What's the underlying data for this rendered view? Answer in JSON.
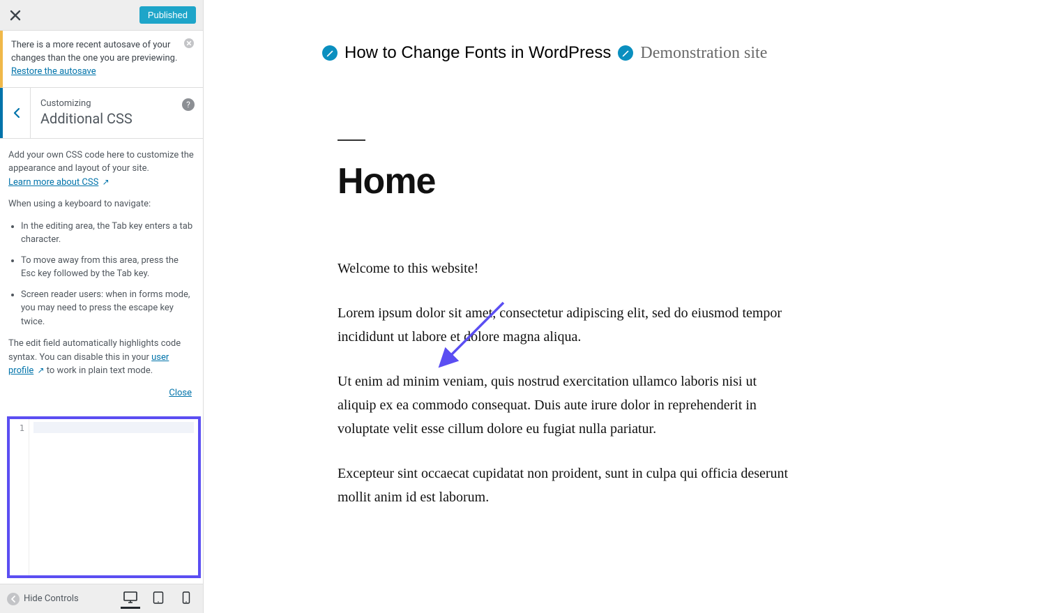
{
  "sidebar": {
    "published_label": "Published",
    "notice_text_before_link": "There is a more recent autosave of your changes than the one you are previewing. ",
    "notice_link": "Restore the autosave",
    "section_eyebrow": "Customizing",
    "section_title": "Additional CSS",
    "help_intro": "Add your own CSS code here to customize the appearance and layout of your site.",
    "help_learn_link": "Learn more about CSS",
    "help_keyboard_intro": "When using a keyboard to navigate:",
    "help_bullets": [
      "In the editing area, the Tab key enters a tab character.",
      "To move away from this area, press the Esc key followed by the Tab key.",
      "Screen reader users: when in forms mode, you may need to press the escape key twice."
    ],
    "help_syntax_before": "The edit field automatically highlights code syntax. You can disable this in your ",
    "help_syntax_link": "user profile",
    "help_syntax_after": " to work in plain text mode.",
    "help_close": "Close",
    "code_line_number": "1",
    "hide_controls": "Hide Controls"
  },
  "preview": {
    "site_title": "How to Change Fonts in WordPress",
    "site_tagline": "Demonstration site",
    "page_title": "Home",
    "p1": "Welcome to this website!",
    "p2": "Lorem ipsum dolor sit amet, consectetur adipiscing elit, sed do eiusmod tempor incididunt ut labore et dolore magna aliqua.",
    "p3": "Ut enim ad minim veniam, quis nostrud exercitation ullamco laboris nisi ut aliquip ex ea commodo consequat. Duis aute irure dolor in reprehenderit in voluptate velit esse cillum dolore eu fugiat nulla pariatur.",
    "p4": "Excepteur sint occaecat cupidatat non proident, sunt in culpa qui officia deserunt mollit anim id est laborum."
  },
  "colors": {
    "accent": "#0073aa",
    "annotation": "#5b4ef2"
  }
}
